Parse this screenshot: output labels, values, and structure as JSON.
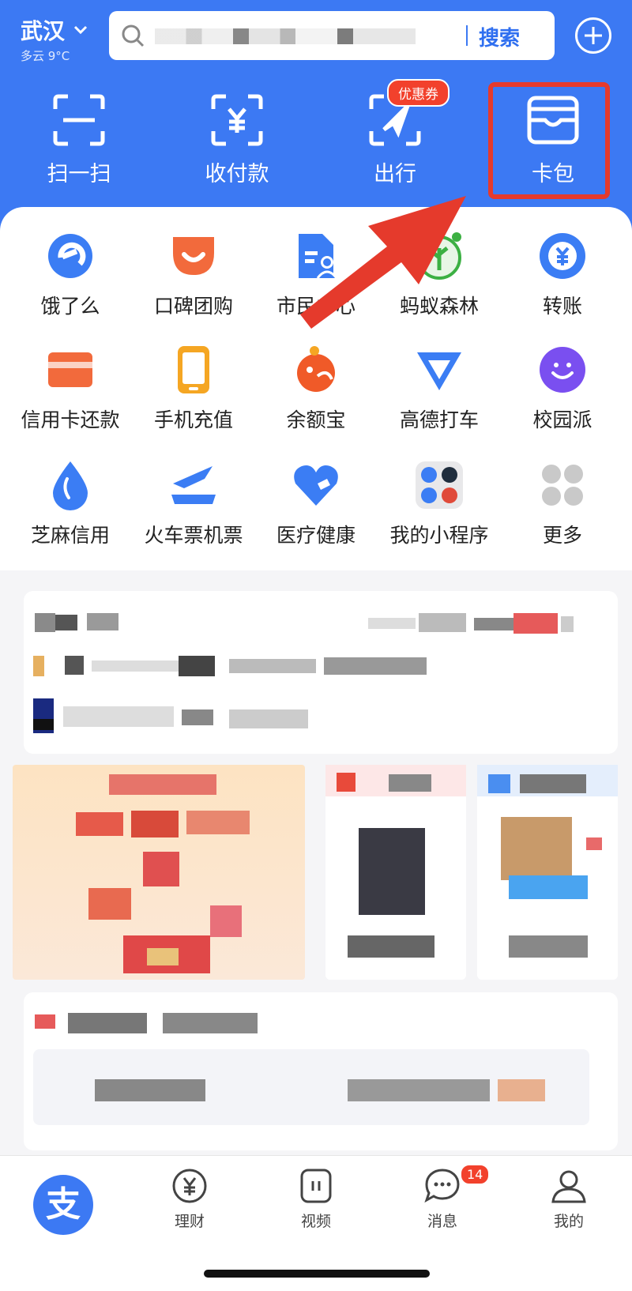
{
  "header": {
    "city": "武汉",
    "weather": "多云 9°C",
    "search_button": "搜索",
    "coupon_badge": "优惠券"
  },
  "quick_actions": [
    {
      "label": "扫一扫",
      "icon": "scan-icon"
    },
    {
      "label": "收付款",
      "icon": "payment-code-icon"
    },
    {
      "label": "出行",
      "icon": "travel-icon"
    },
    {
      "label": "卡包",
      "icon": "card-wallet-icon"
    }
  ],
  "apps": [
    {
      "label": "饿了么",
      "icon": "eleme-icon",
      "color": "#3b7df4"
    },
    {
      "label": "口碑团购",
      "icon": "koubei-icon",
      "color": "#f26a3c"
    },
    {
      "label": "市民中心",
      "icon": "citizen-center-icon",
      "color": "#3b7df4"
    },
    {
      "label": "蚂蚁森林",
      "icon": "ant-forest-icon",
      "color": "#3cb043"
    },
    {
      "label": "转账",
      "icon": "transfer-icon",
      "color": "#3b7df4"
    },
    {
      "label": "信用卡还款",
      "icon": "credit-card-icon",
      "color": "#f26a3c"
    },
    {
      "label": "手机充值",
      "icon": "phone-recharge-icon",
      "color": "#f5a623"
    },
    {
      "label": "余额宝",
      "icon": "yuebao-icon",
      "color": "#f05a28"
    },
    {
      "label": "高德打车",
      "icon": "amap-taxi-icon",
      "color": "#3b7df4"
    },
    {
      "label": "校园派",
      "icon": "campus-icon",
      "color": "#7a4ff0"
    },
    {
      "label": "芝麻信用",
      "icon": "sesame-credit-icon",
      "color": "#3b7df4"
    },
    {
      "label": "火车票机票",
      "icon": "train-plane-icon",
      "color": "#3b7df4"
    },
    {
      "label": "医疗健康",
      "icon": "health-icon",
      "color": "#3b7df4"
    },
    {
      "label": "我的小程序",
      "icon": "mini-program-icon",
      "color": "#999999"
    },
    {
      "label": "更多",
      "icon": "more-icon",
      "color": "#c9c9c9"
    }
  ],
  "bottom_nav": [
    {
      "label": "",
      "icon": "alipay-home-icon"
    },
    {
      "label": "理财",
      "icon": "finance-icon"
    },
    {
      "label": "视频",
      "icon": "video-icon"
    },
    {
      "label": "消息",
      "icon": "message-icon"
    },
    {
      "label": "我的",
      "icon": "profile-icon"
    }
  ],
  "message_badge": "14",
  "colors": {
    "brand": "#3c79f3",
    "highlight": "#e53a2c"
  }
}
